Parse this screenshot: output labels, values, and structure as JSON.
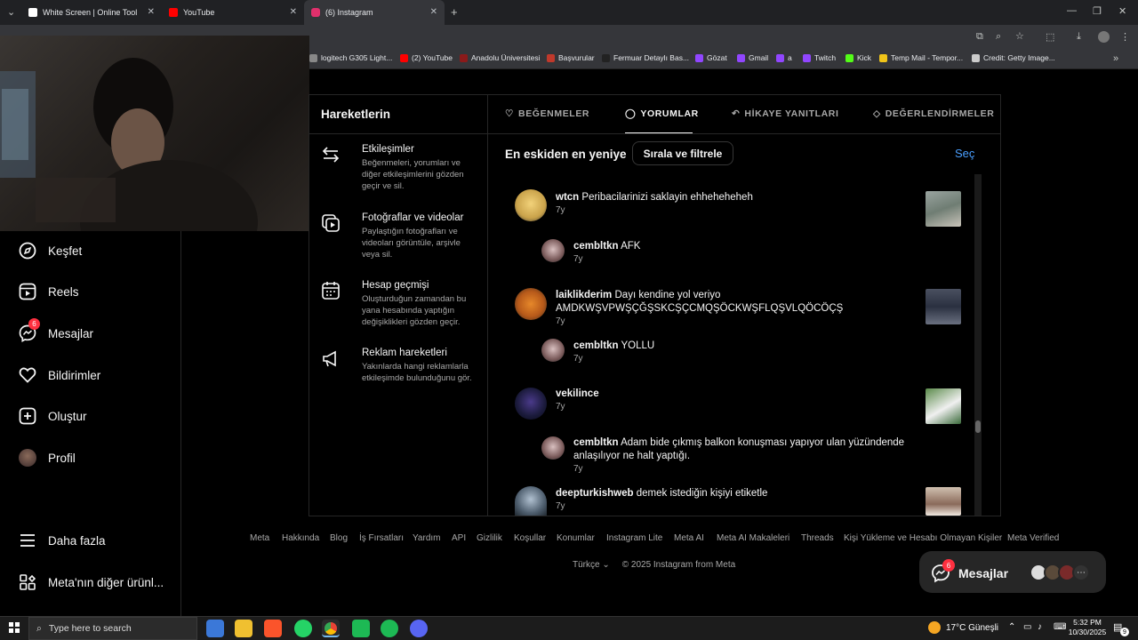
{
  "browser": {
    "tabs": [
      {
        "title": "White Screen | Online Tool"
      },
      {
        "title": "YouTube"
      },
      {
        "title": "(6) Instagram"
      }
    ],
    "bookmarks": [
      {
        "label": "logitech G305 Light...",
        "color": "#888888"
      },
      {
        "label": "(2) YouTube",
        "color": "#ff0000"
      },
      {
        "label": "Anadolu Üniversitesi",
        "color": "#8b1a1a"
      },
      {
        "label": "Başvurular",
        "color": "#c0392b"
      },
      {
        "label": "Fermuar Detaylı Bas...",
        "color": "#222222"
      },
      {
        "label": "Gözat",
        "color": "#9146ff"
      },
      {
        "label": "Gmail",
        "color": "#9146ff"
      },
      {
        "label": "a",
        "color": "#9146ff"
      },
      {
        "label": "Twitch",
        "color": "#9146ff"
      },
      {
        "label": "Kick",
        "color": "#53fc18"
      },
      {
        "label": "Temp Mail - Tempor...",
        "color": "#f0c419"
      },
      {
        "label": "Credit: Getty Image...",
        "color": "#cccccc"
      }
    ]
  },
  "sidebar": {
    "items": [
      {
        "label": "Keşfet",
        "icon": "compass-icon"
      },
      {
        "label": "Reels",
        "icon": "reels-icon"
      },
      {
        "label": "Mesajlar",
        "icon": "messenger-icon",
        "badge": "6"
      },
      {
        "label": "Bildirimler",
        "icon": "heart-icon"
      },
      {
        "label": "Oluştur",
        "icon": "plus-square-icon"
      },
      {
        "label": "Profil",
        "icon": "avatar"
      }
    ],
    "more": "Daha fazla",
    "meta": "Meta'nın diğer ürünl..."
  },
  "activity": {
    "title": "Hareketlerin",
    "menu": [
      {
        "title": "Etkileşimler",
        "desc": "Beğenmeleri, yorumları ve diğer etkileşimlerini gözden geçir ve sil.",
        "icon": "arrows-icon"
      },
      {
        "title": "Fotoğraflar ve videolar",
        "desc": "Paylaştığın fotoğrafları ve videoları görüntüle, arşivle veya sil.",
        "icon": "media-icon"
      },
      {
        "title": "Hesap geçmişi",
        "desc": "Oluşturduğun zamandan bu yana hesabında yaptığın değişiklikleri gözden geçir.",
        "icon": "calendar-icon"
      },
      {
        "title": "Reklam hareketleri",
        "desc": "Yakınlarda hangi reklamlarla etkileşimde bulunduğunu gör.",
        "icon": "megaphone-icon"
      }
    ],
    "tabs": [
      {
        "label": "BEĞENMELER",
        "icon": "heart-icon"
      },
      {
        "label": "YORUMLAR",
        "icon": "comment-icon"
      },
      {
        "label": "HİKAYE YANITLARI",
        "icon": "reply-icon"
      },
      {
        "label": "DEĞERLENDİRMELER",
        "icon": "tag-icon"
      }
    ],
    "sort_label": "En eskiden en yeniye",
    "filter_button": "Sırala ve filtrele",
    "select_link": "Seç",
    "comments": [
      {
        "user": "wtcn",
        "text": "Peribacilarinizi saklayin ehheheheheh",
        "age": "7y",
        "reply": {
          "user": "cembltkn",
          "text": "AFK",
          "age": "7y"
        }
      },
      {
        "user": "laiklikderim",
        "text": "Dayı kendine yol veriyo",
        "text2": "AMDKWŞVPWŞÇĞŞSKCŞÇCMQŞÖCKWŞFLQŞVLQÖCÖÇŞ",
        "age": "7y",
        "reply": {
          "user": "cembltkn",
          "text": "YOLLU",
          "age": "7y"
        }
      },
      {
        "user": "vekilince",
        "text": "",
        "age": "7y",
        "reply": {
          "user": "cembltkn",
          "text": "Adam bide çıkmış balkon konuşması yapıyor ulan yüzündende",
          "text2": "anlaşılıyor ne halt yaptığı.",
          "age": "7y"
        }
      },
      {
        "user": "deepturkishweb",
        "text": "demek istediğin kişiyi etiketle",
        "age": "7y"
      }
    ]
  },
  "footer": {
    "links": [
      "Meta",
      "Hakkında",
      "Blog",
      "İş Fırsatları",
      "Yardım",
      "API",
      "Gizlilik",
      "Koşullar",
      "Konumlar",
      "Instagram Lite",
      "Meta AI",
      "Meta AI Makaleleri",
      "Threads",
      "Kişi Yükleme ve Hesabı Olmayan Kişiler",
      "Meta Verified"
    ],
    "language": "Türkçe",
    "copyright": "© 2025 Instagram from Meta"
  },
  "messages_pill": {
    "label": "Mesajlar",
    "badge": "6"
  },
  "taskbar": {
    "search": "Type here to search",
    "weather": "17°C Güneşli",
    "time": "5:32 PM",
    "date": "10/30/2025",
    "notif": "9"
  }
}
